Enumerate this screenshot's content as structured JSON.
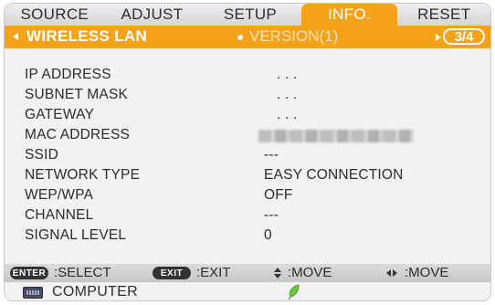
{
  "tabs": [
    {
      "label": "SOURCE",
      "active": false
    },
    {
      "label": "ADJUST",
      "active": false
    },
    {
      "label": "SETUP",
      "active": false
    },
    {
      "label": "INFO.",
      "active": true
    },
    {
      "label": "RESET",
      "active": false
    }
  ],
  "subbar": {
    "title": "WIRELESS LAN",
    "next_page": "VERSION(1)",
    "page_indicator": "3/4"
  },
  "info_rows": [
    {
      "label": "IP ADDRESS",
      "value": ". . ."
    },
    {
      "label": "SUBNET MASK",
      "value": ". . ."
    },
    {
      "label": "GATEWAY",
      "value": ". . ."
    },
    {
      "label": "MAC ADDRESS",
      "value": ""
    },
    {
      "label": "SSID",
      "value": "---"
    },
    {
      "label": "NETWORK TYPE",
      "value": "EASY CONNECTION"
    },
    {
      "label": "WEP/WPA",
      "value": "OFF"
    },
    {
      "label": "CHANNEL",
      "value": "---"
    },
    {
      "label": "SIGNAL LEVEL",
      "value": "0"
    }
  ],
  "helpbar": {
    "enter_key": "ENTER",
    "enter_text": ":SELECT",
    "exit_key": "EXIT",
    "exit_text": ":EXIT",
    "updown_text": ":MOVE",
    "leftright_text": ":MOVE"
  },
  "sourcebar": {
    "source": "COMPUTER",
    "icons": [
      "computer-input-icon",
      "eco-leaf-icon"
    ]
  },
  "colors": {
    "accent": "#f4a21a",
    "background": "#f2f2f2",
    "text": "#2b2b2b",
    "leaf": "#5cbf2a"
  }
}
